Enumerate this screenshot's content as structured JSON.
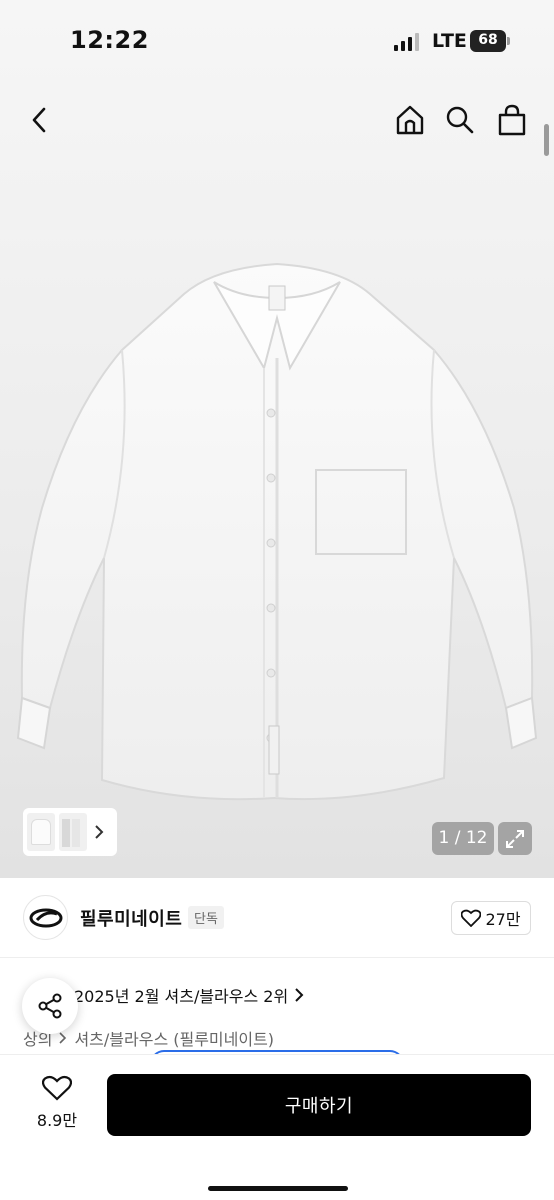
{
  "status_bar": {
    "time": "12:22",
    "network": "LTE",
    "battery": "68"
  },
  "nav": {
    "back": "chevron-left-icon",
    "home": "home-icon",
    "search": "search-icon",
    "bag": "shopping-bag-icon"
  },
  "gallery": {
    "counter": "1 / 12"
  },
  "brand": {
    "name": "필루미네이트",
    "badge": "단독",
    "likes": "27만"
  },
  "ranking": {
    "text": "2025년 2월 셔츠/블라우스 2위"
  },
  "breadcrumb": {
    "items": [
      "상의",
      "셔츠/블라우스 (필루미네이트)"
    ]
  },
  "bottom_bar": {
    "wish_count": "8.9만",
    "buy_label": "구매하기"
  },
  "colors": {
    "buy_button": "#000000",
    "chip_outline": "#2b6de8"
  }
}
